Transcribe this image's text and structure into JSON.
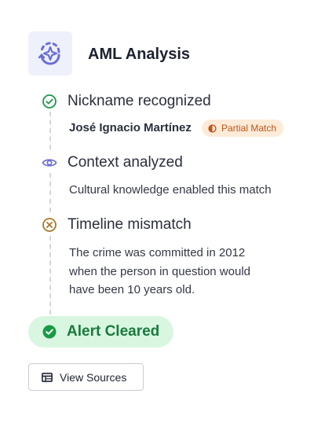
{
  "header": {
    "icon": "sparkle-refresh-icon",
    "title": "AML Analysis"
  },
  "steps": [
    {
      "icon": "check-circle-icon",
      "title": "Nickname recognized",
      "name": "José Ignacio Martínez",
      "badge": {
        "icon": "half-circle-icon",
        "label": "Partial Match"
      }
    },
    {
      "icon": "eye-icon",
      "title": "Context analyzed",
      "description": "Cultural knowledge enabled this match"
    },
    {
      "icon": "x-circle-icon",
      "title": "Timeline mismatch",
      "description_lines": [
        "The crime was committed in 2012",
        "when the person in question would",
        "have been 10 years old."
      ]
    }
  ],
  "result": {
    "icon": "check-circle-filled-icon",
    "label": "Alert Cleared"
  },
  "actions": {
    "view_sources": {
      "icon": "table-icon",
      "label": "View Sources"
    }
  },
  "colors": {
    "accent": "#6a6fd6",
    "success": "#1a9a47",
    "success_bg": "#d9f6e1",
    "warning": "#a8772a",
    "badge_bg": "#fdebd8",
    "badge_text": "#c2541a"
  }
}
